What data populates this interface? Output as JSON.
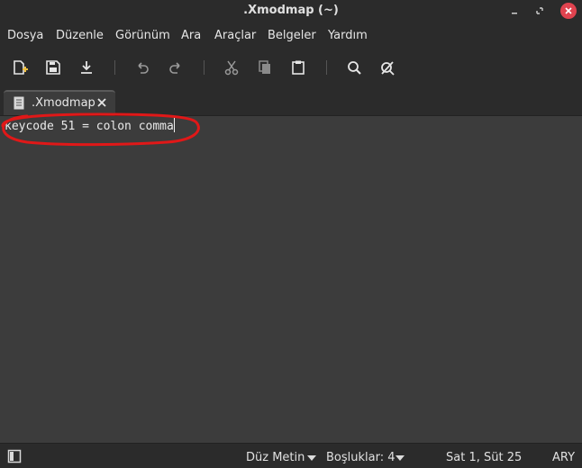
{
  "window": {
    "title": ".Xmodmap (~)",
    "close_color": "#e0434f"
  },
  "menu": {
    "items": [
      "Dosya",
      "Düzenle",
      "Görünüm",
      "Ara",
      "Araçlar",
      "Belgeler",
      "Yardım"
    ]
  },
  "toolbar": {
    "buttons": [
      "new-document-icon",
      "save-icon",
      "download-icon",
      "undo-icon",
      "redo-icon",
      "cut-icon",
      "copy-icon",
      "paste-icon",
      "search-icon",
      "clear-highlight-icon"
    ]
  },
  "tab": {
    "label": ".Xmodmap"
  },
  "editor": {
    "line1": "keycode 51 = colon comma",
    "annotation_color": "#e01818"
  },
  "statusbar": {
    "language": "Düz Metin",
    "indent": "Boşluklar: 4",
    "position": "Sat 1, Süt 25",
    "mode": "ARY"
  }
}
